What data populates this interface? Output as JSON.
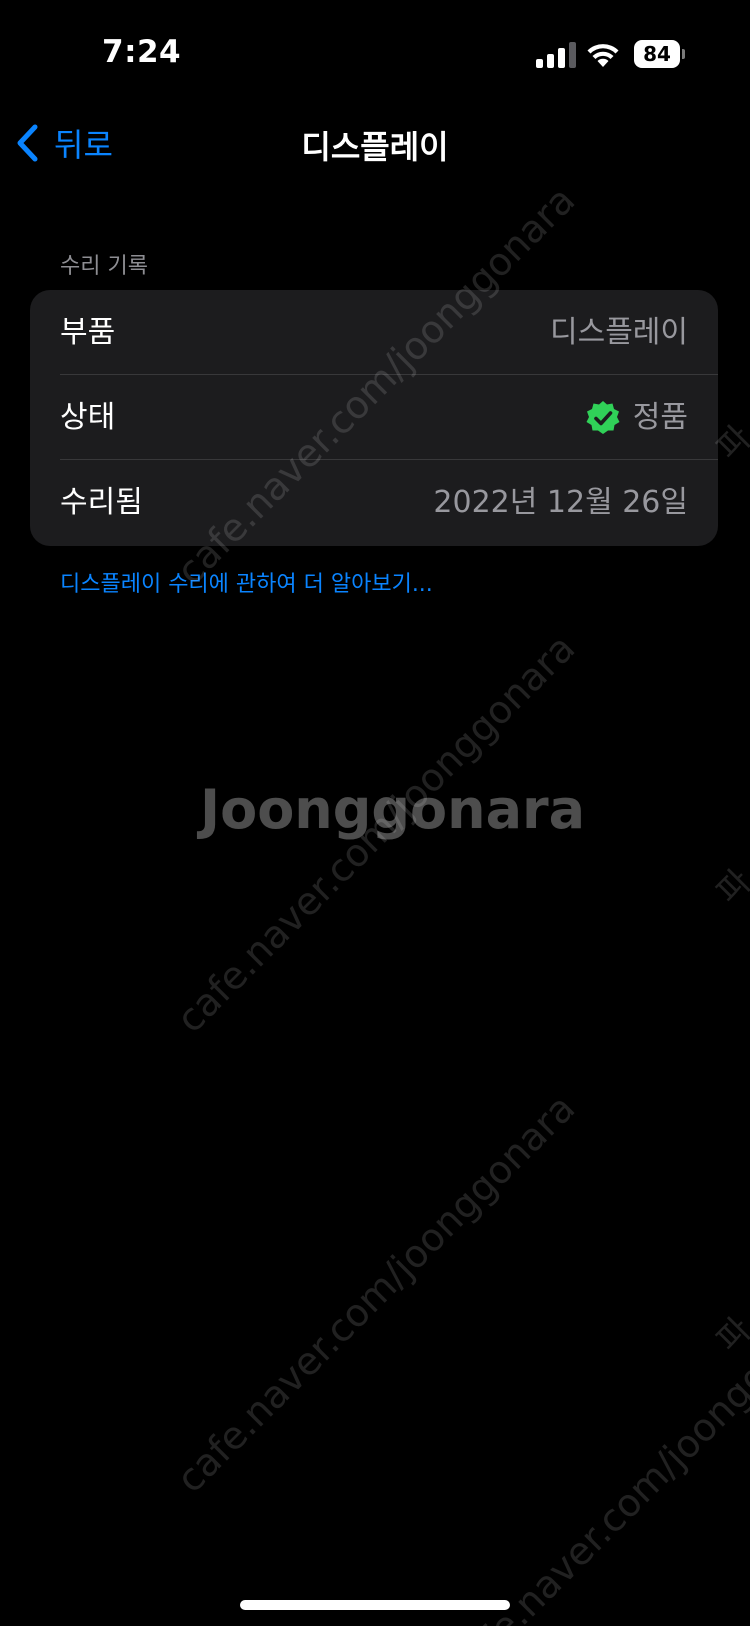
{
  "status_bar": {
    "time": "7:24",
    "battery_level": "84",
    "signal_bars": 3,
    "signal_bars_total": 4
  },
  "nav": {
    "back_label": "뒤로",
    "title": "디스플레이"
  },
  "section": {
    "header": "수리 기록",
    "rows": [
      {
        "label": "부품",
        "value": "디스플레이"
      },
      {
        "label": "상태",
        "value": "정품",
        "icon": "verified-check-icon"
      },
      {
        "label": "수리됨",
        "value": "2022년 12월 26일"
      }
    ]
  },
  "learn_more_link": "디스플레이 수리에 관하여 더 알아보기...",
  "watermark": {
    "url": "cafe.naver.com/joonggonara",
    "logo": "Joonggonara",
    "edge_text": "파"
  },
  "colors": {
    "accent": "#0a84ff",
    "background": "#000000",
    "group_background": "#1c1c1e",
    "verified_green": "#30d158",
    "secondary_text": "#98989e"
  }
}
